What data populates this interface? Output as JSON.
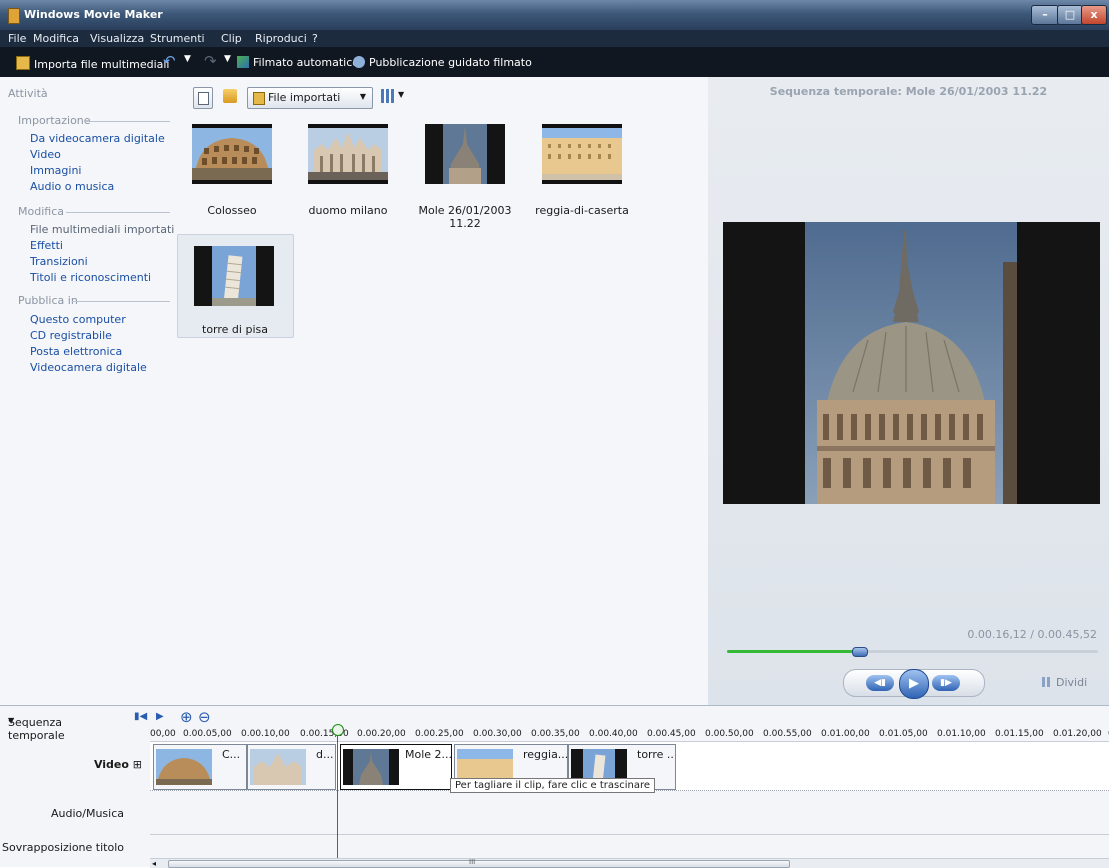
{
  "window": {
    "title": "Windows Movie Maker",
    "min": "–",
    "max": "□",
    "close": "x"
  },
  "menu": [
    "File",
    "Modifica",
    "Visualizza",
    "Strumenti",
    "Clip",
    "Riproduci",
    "?"
  ],
  "toolbar": {
    "import": "Importa file multimediali",
    "auto_movie": "Filmato automatico",
    "publish": "Pubblicazione guidato filmato"
  },
  "tasks": {
    "title": "Attività",
    "sections": [
      {
        "header": "Importazione",
        "items": [
          "Da videocamera digitale",
          "Video",
          "Immagini",
          "Audio o musica"
        ]
      },
      {
        "header": "Modifica",
        "items": [
          "File multimediali importati",
          "Effetti",
          "Transizioni",
          "Titoli e riconoscimenti"
        ]
      },
      {
        "header": "Pubblica in",
        "items": [
          "Questo computer",
          "CD registrabile",
          "Posta elettronica",
          "Videocamera digitale"
        ]
      }
    ]
  },
  "collection": {
    "dropdown": "File importati",
    "items": [
      {
        "label": "Colosseo"
      },
      {
        "label": "duomo milano"
      },
      {
        "label": "Mole 26/01/2003 11.22"
      },
      {
        "label": "reggia-di-caserta"
      },
      {
        "label": "torre di pisa"
      }
    ]
  },
  "preview": {
    "title": "Sequenza temporale: Mole 26/01/2003 11.22",
    "timecode": "0.00.16,12 / 0.00.45,52",
    "progress": 0.355,
    "split": "Dividi"
  },
  "timeline": {
    "mode": "Sequenza temporale",
    "ruler": [
      "00,00",
      "0.00.05,00",
      "0.00.10,00",
      "0.00.15,00",
      "0.00.20,00",
      "0.00.25,00",
      "0.00.30,00",
      "0.00.35,00",
      "0.00.40,00",
      "0.00.45,00",
      "0.00.50,00",
      "0.00.55,00",
      "0.01.00,00",
      "0.01.05,00",
      "0.01.10,00",
      "0.01.15,00",
      "0.01.20,00",
      "0"
    ],
    "tracks": {
      "video": "Video",
      "expand": "⊞",
      "audio": "Audio/Musica",
      "overlay": "Sovrapposizione titolo"
    },
    "clips": [
      "C...",
      "d...",
      "Mole 2...",
      "reggia...",
      "torre ..."
    ],
    "tooltip": "Per tagliare il clip, fare clic e trascinare",
    "scroll_grip": "III"
  }
}
